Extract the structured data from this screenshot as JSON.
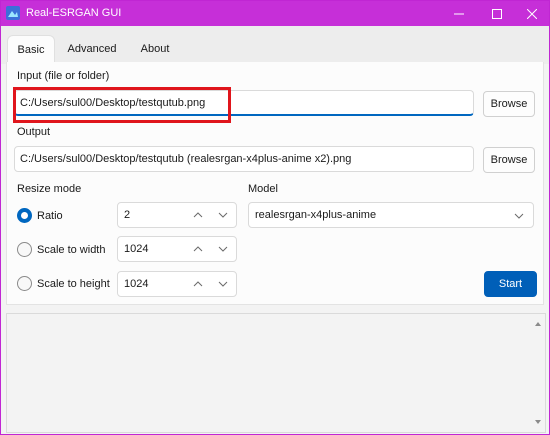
{
  "window": {
    "title": "Real-ESRGAN GUI",
    "accent": "#c62fd8"
  },
  "tabs": [
    {
      "label": "Basic"
    },
    {
      "label": "Advanced"
    },
    {
      "label": "About"
    }
  ],
  "input": {
    "label": "Input (file or folder)",
    "value": "C:/Users/sul00/Desktop/testqutub.png",
    "browse": "Browse"
  },
  "output": {
    "label": "Output",
    "value": "C:/Users/sul00/Desktop/testqutub (realesrgan-x4plus-anime x2).png",
    "browse": "Browse"
  },
  "resize": {
    "label": "Resize mode",
    "ratio": {
      "label": "Ratio",
      "value": "2",
      "selected": true
    },
    "width": {
      "label": "Scale to width",
      "value": "1024",
      "selected": false
    },
    "height": {
      "label": "Scale to height",
      "value": "1024",
      "selected": false
    }
  },
  "model": {
    "label": "Model",
    "value": "realesrgan-x4plus-anime"
  },
  "start_label": "Start"
}
